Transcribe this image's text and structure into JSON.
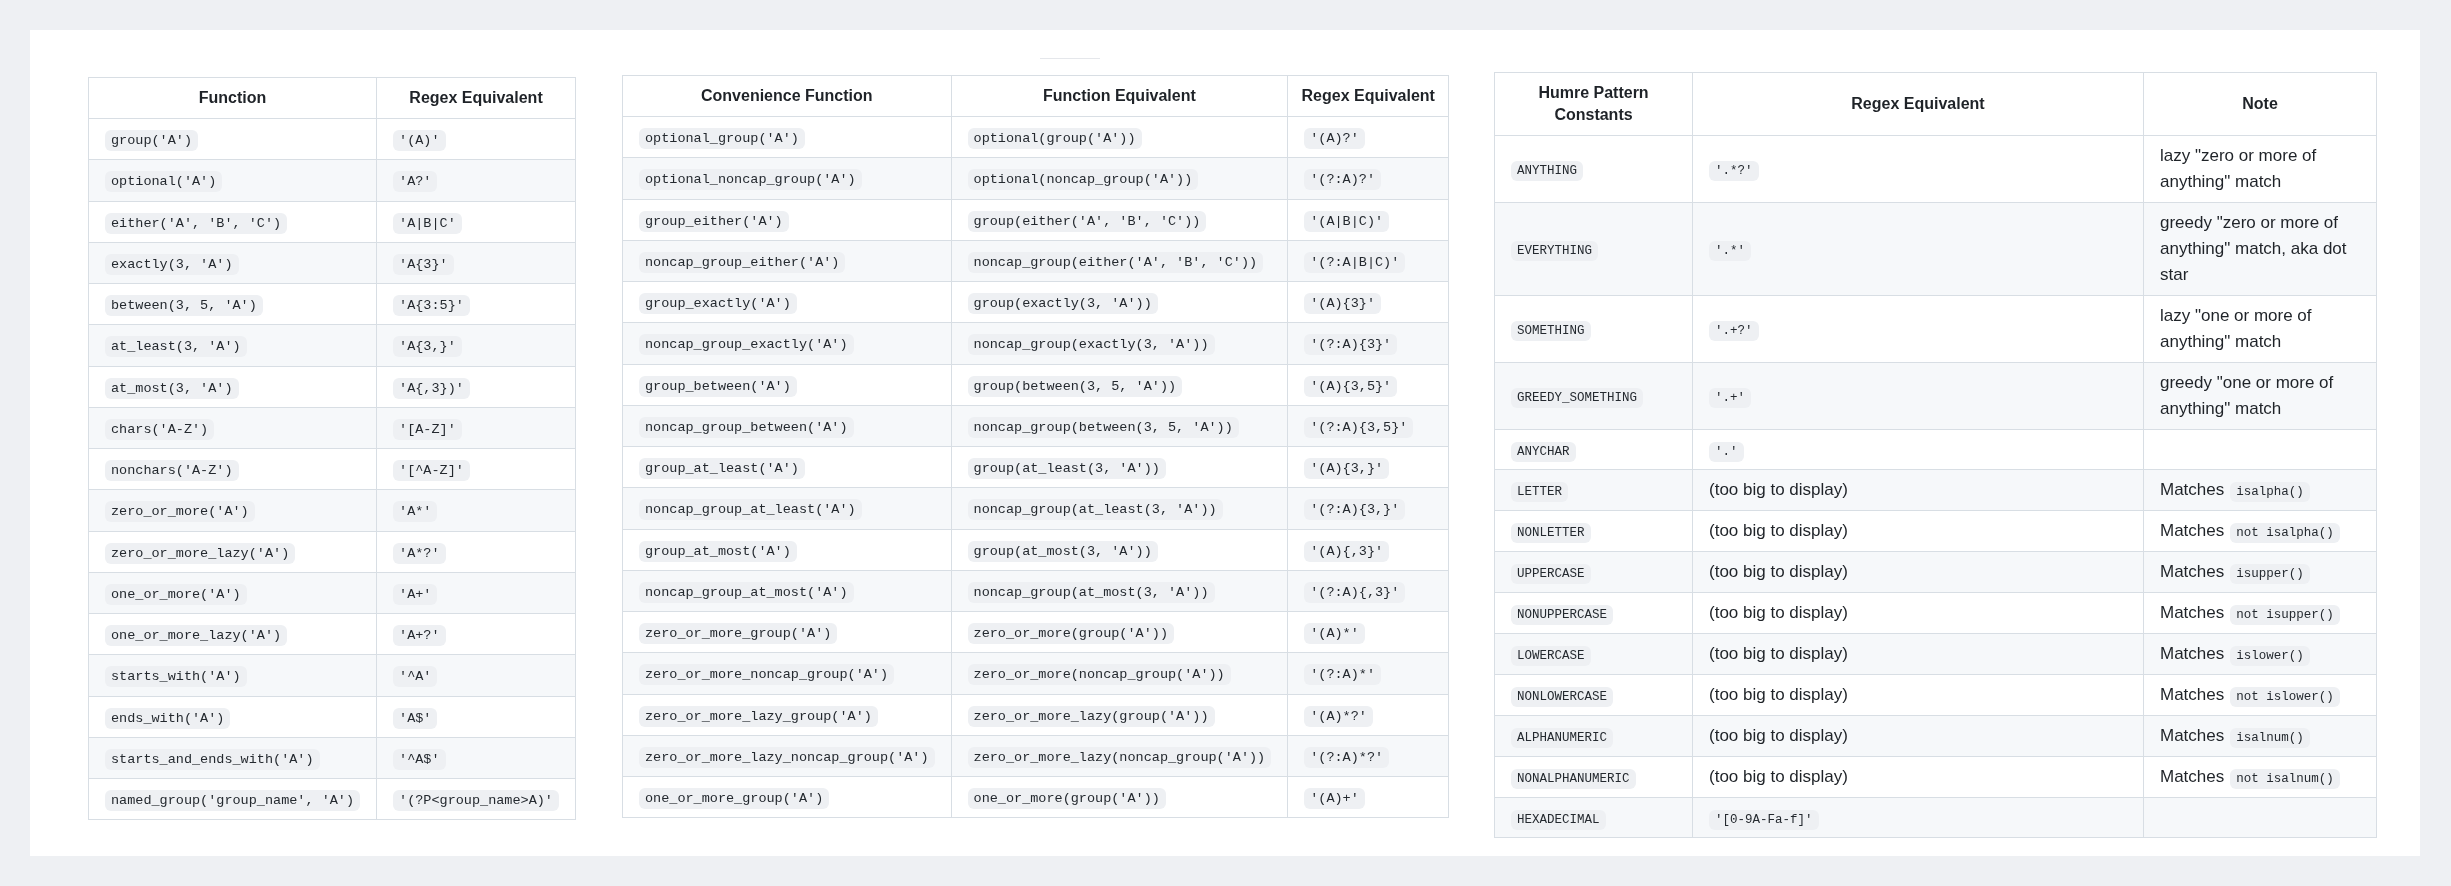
{
  "tables": [
    {
      "columns": [
        "Function",
        "Regex Equivalent"
      ],
      "rows": [
        [
          {
            "kind": "code",
            "text": "group('A')"
          },
          {
            "kind": "code",
            "text": "'(A)'"
          }
        ],
        [
          {
            "kind": "code",
            "text": "optional('A')"
          },
          {
            "kind": "code",
            "text": "'A?'"
          }
        ],
        [
          {
            "kind": "code",
            "text": "either('A', 'B', 'C')"
          },
          {
            "kind": "code",
            "text": "'A|B|C'"
          }
        ],
        [
          {
            "kind": "code",
            "text": "exactly(3, 'A')"
          },
          {
            "kind": "code",
            "text": "'A{3}'"
          }
        ],
        [
          {
            "kind": "code",
            "text": "between(3, 5, 'A')"
          },
          {
            "kind": "code",
            "text": "'A{3:5}'"
          }
        ],
        [
          {
            "kind": "code",
            "text": "at_least(3, 'A')"
          },
          {
            "kind": "code",
            "text": "'A{3,}'"
          }
        ],
        [
          {
            "kind": "code",
            "text": "at_most(3, 'A')"
          },
          {
            "kind": "code",
            "text": "'A{,3})'"
          }
        ],
        [
          {
            "kind": "code",
            "text": "chars('A-Z')"
          },
          {
            "kind": "code",
            "text": "'[A-Z]'"
          }
        ],
        [
          {
            "kind": "code",
            "text": "nonchars('A-Z')"
          },
          {
            "kind": "code",
            "text": "'[^A-Z]'"
          }
        ],
        [
          {
            "kind": "code",
            "text": "zero_or_more('A')"
          },
          {
            "kind": "code",
            "text": "'A*'"
          }
        ],
        [
          {
            "kind": "code",
            "text": "zero_or_more_lazy('A')"
          },
          {
            "kind": "code",
            "text": "'A*?'"
          }
        ],
        [
          {
            "kind": "code",
            "text": "one_or_more('A')"
          },
          {
            "kind": "code",
            "text": "'A+'"
          }
        ],
        [
          {
            "kind": "code",
            "text": "one_or_more_lazy('A')"
          },
          {
            "kind": "code",
            "text": "'A+?'"
          }
        ],
        [
          {
            "kind": "code",
            "text": "starts_with('A')"
          },
          {
            "kind": "code",
            "text": "'^A'"
          }
        ],
        [
          {
            "kind": "code",
            "text": "ends_with('A')"
          },
          {
            "kind": "code",
            "text": "'A$'"
          }
        ],
        [
          {
            "kind": "code",
            "text": "starts_and_ends_with('A')"
          },
          {
            "kind": "code",
            "text": "'^A$'"
          }
        ],
        [
          {
            "kind": "code",
            "text": "named_group('group_name', 'A')"
          },
          {
            "kind": "code",
            "text": "'(?P<group_name>A)'"
          }
        ]
      ]
    },
    {
      "columns": [
        "Convenience Function",
        "Function Equivalent",
        "Regex Equivalent"
      ],
      "rows": [
        [
          {
            "kind": "code",
            "text": "optional_group('A')"
          },
          {
            "kind": "code",
            "text": "optional(group('A'))"
          },
          {
            "kind": "code",
            "text": "'(A)?'"
          }
        ],
        [
          {
            "kind": "code",
            "text": "optional_noncap_group('A')"
          },
          {
            "kind": "code",
            "text": "optional(noncap_group('A'))"
          },
          {
            "kind": "code",
            "text": "'(?:A)?'"
          }
        ],
        [
          {
            "kind": "code",
            "text": "group_either('A')"
          },
          {
            "kind": "code",
            "text": "group(either('A', 'B', 'C'))"
          },
          {
            "kind": "code",
            "text": "'(A|B|C)'"
          }
        ],
        [
          {
            "kind": "code",
            "text": "noncap_group_either('A')"
          },
          {
            "kind": "code",
            "text": "noncap_group(either('A', 'B', 'C'))"
          },
          {
            "kind": "code",
            "text": "'(?:A|B|C)'"
          }
        ],
        [
          {
            "kind": "code",
            "text": "group_exactly('A')"
          },
          {
            "kind": "code",
            "text": "group(exactly(3, 'A'))"
          },
          {
            "kind": "code",
            "text": "'(A){3}'"
          }
        ],
        [
          {
            "kind": "code",
            "text": "noncap_group_exactly('A')"
          },
          {
            "kind": "code",
            "text": "noncap_group(exactly(3, 'A'))"
          },
          {
            "kind": "code",
            "text": "'(?:A){3}'"
          }
        ],
        [
          {
            "kind": "code",
            "text": "group_between('A')"
          },
          {
            "kind": "code",
            "text": "group(between(3, 5, 'A'))"
          },
          {
            "kind": "code",
            "text": "'(A){3,5}'"
          }
        ],
        [
          {
            "kind": "code",
            "text": "noncap_group_between('A')"
          },
          {
            "kind": "code",
            "text": "noncap_group(between(3, 5, 'A'))"
          },
          {
            "kind": "code",
            "text": "'(?:A){3,5}'"
          }
        ],
        [
          {
            "kind": "code",
            "text": "group_at_least('A')"
          },
          {
            "kind": "code",
            "text": "group(at_least(3, 'A'))"
          },
          {
            "kind": "code",
            "text": "'(A){3,}'"
          }
        ],
        [
          {
            "kind": "code",
            "text": "noncap_group_at_least('A')"
          },
          {
            "kind": "code",
            "text": "noncap_group(at_least(3, 'A'))"
          },
          {
            "kind": "code",
            "text": "'(?:A){3,}'"
          }
        ],
        [
          {
            "kind": "code",
            "text": "group_at_most('A')"
          },
          {
            "kind": "code",
            "text": "group(at_most(3, 'A'))"
          },
          {
            "kind": "code",
            "text": "'(A){,3}'"
          }
        ],
        [
          {
            "kind": "code",
            "text": "noncap_group_at_most('A')"
          },
          {
            "kind": "code",
            "text": "noncap_group(at_most(3, 'A'))"
          },
          {
            "kind": "code",
            "text": "'(?:A){,3}'"
          }
        ],
        [
          {
            "kind": "code",
            "text": "zero_or_more_group('A')"
          },
          {
            "kind": "code",
            "text": "zero_or_more(group('A'))"
          },
          {
            "kind": "code",
            "text": "'(A)*'"
          }
        ],
        [
          {
            "kind": "code",
            "text": "zero_or_more_noncap_group('A')"
          },
          {
            "kind": "code",
            "text": "zero_or_more(noncap_group('A'))"
          },
          {
            "kind": "code",
            "text": "'(?:A)*'"
          }
        ],
        [
          {
            "kind": "code",
            "text": "zero_or_more_lazy_group('A')"
          },
          {
            "kind": "code",
            "text": "zero_or_more_lazy(group('A'))"
          },
          {
            "kind": "code",
            "text": "'(A)*?'"
          }
        ],
        [
          {
            "kind": "code",
            "text": "zero_or_more_lazy_noncap_group('A')"
          },
          {
            "kind": "code",
            "text": "zero_or_more_lazy(noncap_group('A'))"
          },
          {
            "kind": "code",
            "text": "'(?:A)*?'"
          }
        ],
        [
          {
            "kind": "code",
            "text": "one_or_more_group('A')"
          },
          {
            "kind": "code",
            "text": "one_or_more(group('A'))"
          },
          {
            "kind": "code",
            "text": "'(A)+'"
          }
        ]
      ]
    },
    {
      "columns": [
        "Humre Pattern Constants",
        "Regex Equivalent",
        "Note"
      ],
      "rows": [
        [
          {
            "kind": "code",
            "text": "ANYTHING"
          },
          {
            "kind": "code",
            "text": "'.*?'"
          },
          {
            "kind": "text",
            "text": "lazy \"zero or more of anything\" match"
          }
        ],
        [
          {
            "kind": "code",
            "text": "EVERYTHING"
          },
          {
            "kind": "code",
            "text": "'.*'"
          },
          {
            "kind": "text",
            "text": "greedy \"zero or more of anything\" match, aka dot star"
          }
        ],
        [
          {
            "kind": "code",
            "text": "SOMETHING"
          },
          {
            "kind": "code",
            "text": "'.+?'"
          },
          {
            "kind": "text",
            "text": "lazy \"one or more of anything\" match"
          }
        ],
        [
          {
            "kind": "code",
            "text": "GREEDY_SOMETHING"
          },
          {
            "kind": "code",
            "text": "'.+'"
          },
          {
            "kind": "text",
            "text": "greedy \"one or more of anything\" match"
          }
        ],
        [
          {
            "kind": "code",
            "text": "ANYCHAR"
          },
          {
            "kind": "code",
            "text": "'.'"
          }
        ],
        [
          {
            "kind": "code",
            "text": "LETTER"
          },
          {
            "kind": "text",
            "text": "(too big to display)"
          },
          {
            "kind": "mixed",
            "text": "Matches",
            "code": "isalpha()"
          }
        ],
        [
          {
            "kind": "code",
            "text": "NONLETTER"
          },
          {
            "kind": "text",
            "text": "(too big to display)"
          },
          {
            "kind": "mixed",
            "text": "Matches",
            "code": "not isalpha()"
          }
        ],
        [
          {
            "kind": "code",
            "text": "UPPERCASE"
          },
          {
            "kind": "text",
            "text": "(too big to display)"
          },
          {
            "kind": "mixed",
            "text": "Matches",
            "code": "isupper()"
          }
        ],
        [
          {
            "kind": "code",
            "text": "NONUPPERCASE"
          },
          {
            "kind": "text",
            "text": "(too big to display)"
          },
          {
            "kind": "mixed",
            "text": "Matches",
            "code": "not isupper()"
          }
        ],
        [
          {
            "kind": "code",
            "text": "LOWERCASE"
          },
          {
            "kind": "text",
            "text": "(too big to display)"
          },
          {
            "kind": "mixed",
            "text": "Matches",
            "code": "islower()"
          }
        ],
        [
          {
            "kind": "code",
            "text": "NONLOWERCASE"
          },
          {
            "kind": "text",
            "text": "(too big to display)"
          },
          {
            "kind": "mixed",
            "text": "Matches",
            "code": "not islower()"
          }
        ],
        [
          {
            "kind": "code",
            "text": "ALPHANUMERIC"
          },
          {
            "kind": "text",
            "text": "(too big to display)"
          },
          {
            "kind": "mixed",
            "text": "Matches",
            "code": "isalnum()"
          }
        ],
        [
          {
            "kind": "code",
            "text": "NONALPHANUMERIC"
          },
          {
            "kind": "text",
            "text": "(too big to display)"
          },
          {
            "kind": "mixed",
            "text": "Matches",
            "code": "not isalnum()"
          }
        ],
        [
          {
            "kind": "code",
            "text": "HEXADECIMAL"
          },
          {
            "kind": "code",
            "text": "'[0-9A-Fa-f]'"
          }
        ]
      ]
    }
  ]
}
